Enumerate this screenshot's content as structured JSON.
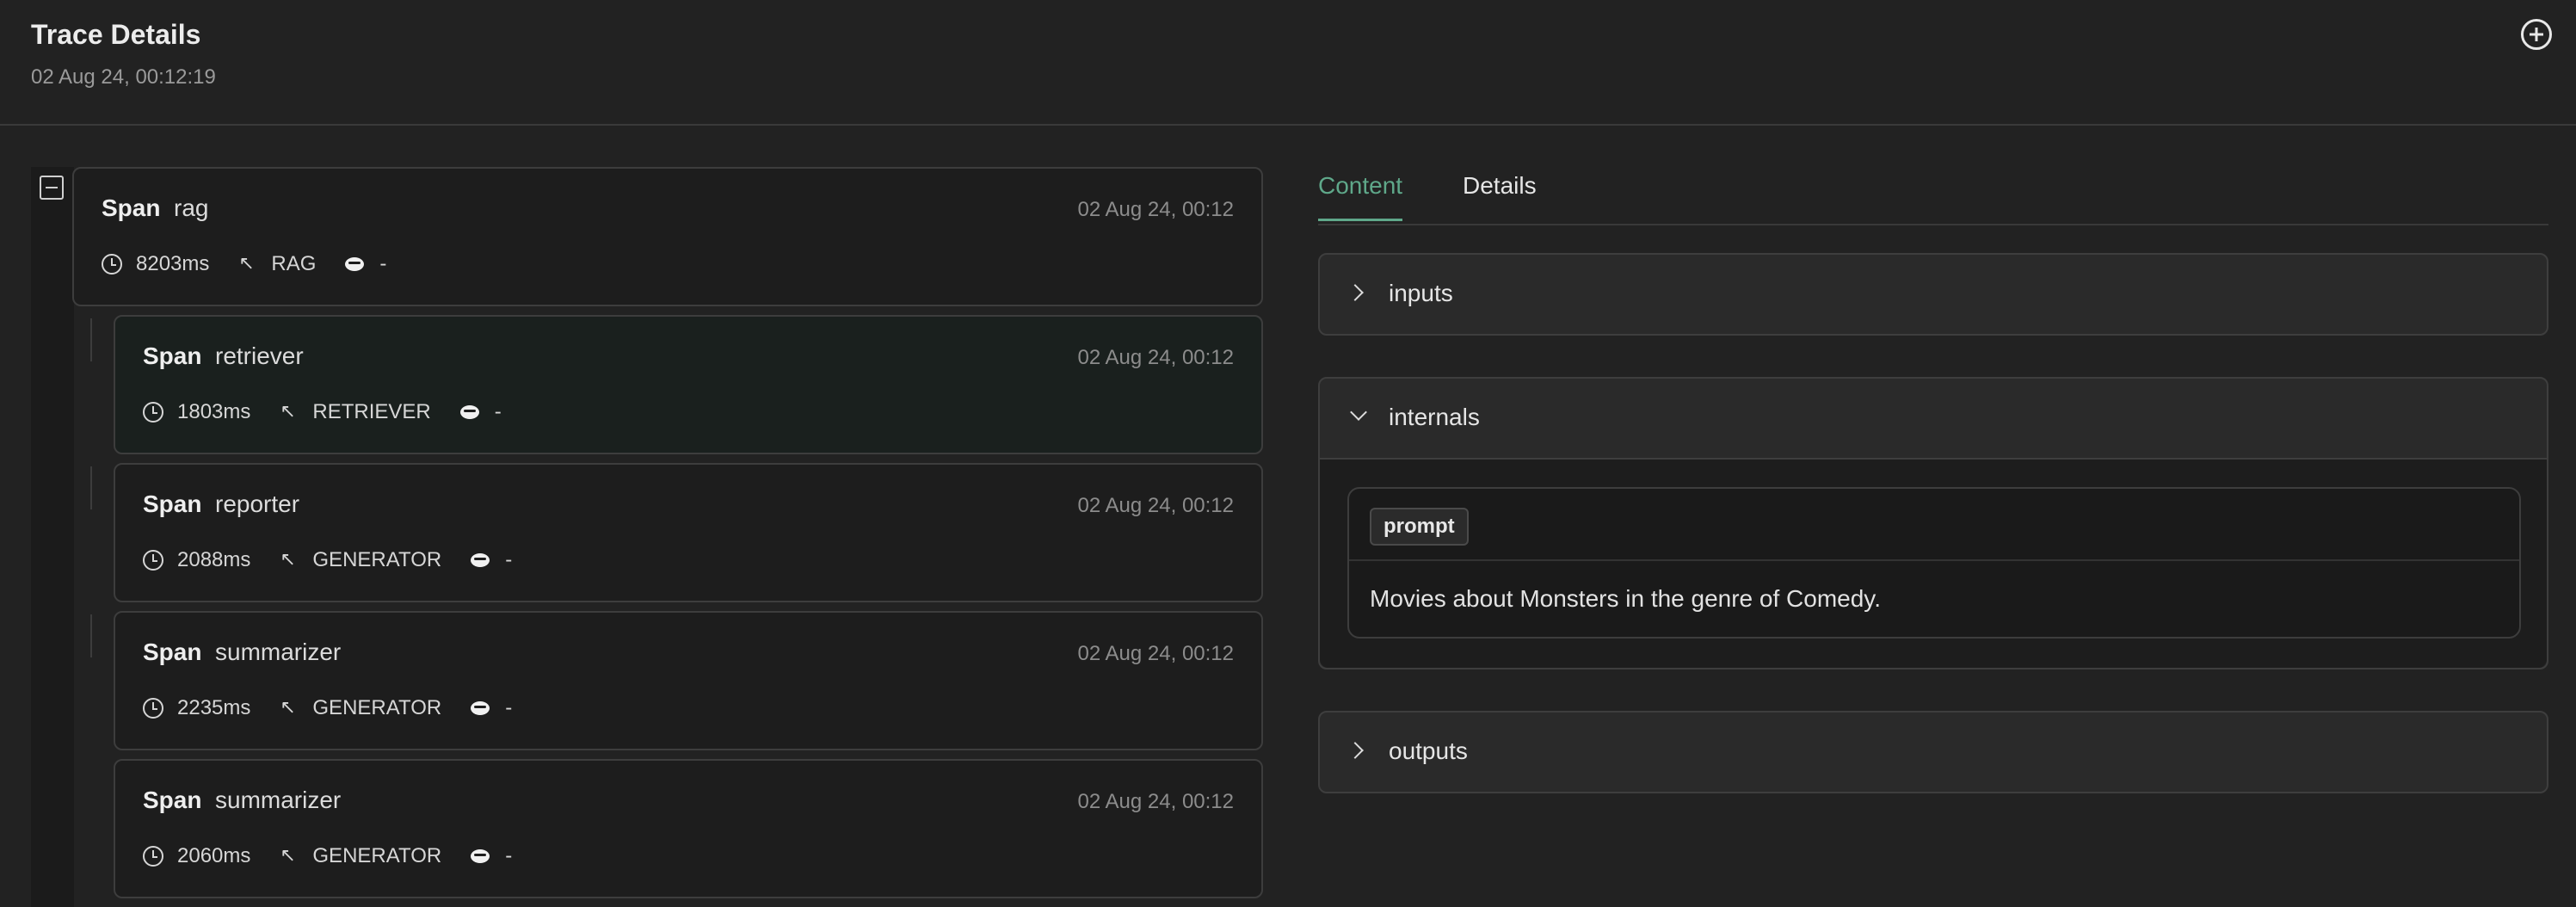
{
  "header": {
    "title": "Trace Details",
    "timestamp": "02 Aug 24, 00:12:19"
  },
  "spans": [
    {
      "kind": "Span",
      "name": "rag",
      "time": "02 Aug 24, 00:12",
      "duration": "8203ms",
      "type": "RAG",
      "tokens": "-"
    },
    {
      "kind": "Span",
      "name": "retriever",
      "time": "02 Aug 24, 00:12",
      "duration": "1803ms",
      "type": "RETRIEVER",
      "tokens": "-"
    },
    {
      "kind": "Span",
      "name": "reporter",
      "time": "02 Aug 24, 00:12",
      "duration": "2088ms",
      "type": "GENERATOR",
      "tokens": "-"
    },
    {
      "kind": "Span",
      "name": "summarizer",
      "time": "02 Aug 24, 00:12",
      "duration": "2235ms",
      "type": "GENERATOR",
      "tokens": "-"
    },
    {
      "kind": "Span",
      "name": "summarizer",
      "time": "02 Aug 24, 00:12",
      "duration": "2060ms",
      "type": "GENERATOR",
      "tokens": "-"
    }
  ],
  "tabs": [
    {
      "label": "Content",
      "active": true
    },
    {
      "label": "Details",
      "active": false
    }
  ],
  "sections": {
    "inputs": {
      "label": "inputs"
    },
    "internals": {
      "label": "internals",
      "badge": "prompt",
      "text": "Movies about Monsters in the genre of Comedy."
    },
    "outputs": {
      "label": "outputs"
    }
  },
  "colors": {
    "accent": "#5fa88a",
    "background": "#222222",
    "card": "#1d1d1d"
  }
}
